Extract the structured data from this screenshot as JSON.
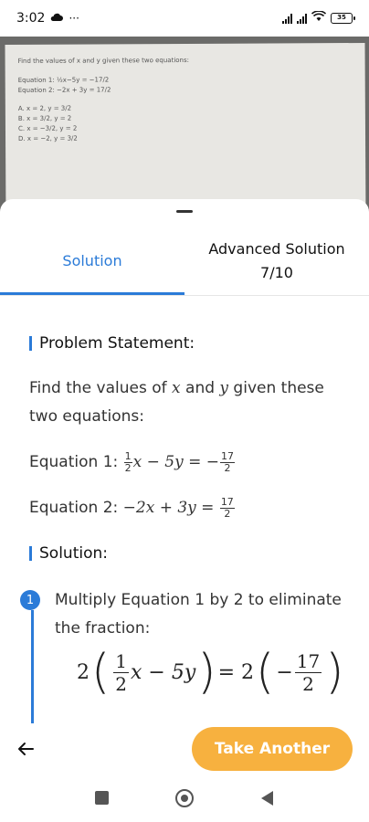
{
  "status_bar": {
    "time": "3:02",
    "battery": "35",
    "icons": [
      "cloud-icon",
      "more-dots-icon",
      "signal-icon",
      "wifi-icon",
      "battery-icon"
    ]
  },
  "photo": {
    "prompt": "Find the values of x and y given these two equations:",
    "eq1": "Equation 1: ½x−5y = −17/2",
    "eq2": "Equation 2: −2x + 3y = 17/2",
    "options": [
      "A. x = 2, y = 3/2",
      "B. x = 3/2, y = 2",
      "C. x = −3/2, y = 2",
      "D. x = −2, y = 3/2"
    ]
  },
  "tabs": [
    {
      "label": "Solution",
      "active": true
    },
    {
      "label": "Advanced Solution",
      "sublabel": "7/10",
      "active": false
    }
  ],
  "problem": {
    "heading": "Problem Statement:",
    "text_a": "Find the values of ",
    "var_x": "x",
    "text_b": " and ",
    "var_y": "y",
    "text_c": " given these two equations:",
    "eq1_label": "Equation 1: ",
    "eq1_frac_num": "1",
    "eq1_frac_den": "2",
    "eq1_mid": "x − 5y = −",
    "eq1_rhs_num": "17",
    "eq1_rhs_den": "2",
    "eq2_label": "Equation 2: ",
    "eq2_mid": "−2x + 3y = ",
    "eq2_rhs_num": "17",
    "eq2_rhs_den": "2"
  },
  "solution": {
    "heading": "Solution:",
    "steps": [
      {
        "number": "1",
        "text": "Multiply Equation 1 by 2 to eliminate the fraction:",
        "math": {
          "lead": "2",
          "frac_num": "1",
          "frac_den": "2",
          "inner": "x − 5y",
          "eq": " = 2",
          "neg": "−",
          "rhs_num": "17",
          "rhs_den": "2"
        }
      }
    ]
  },
  "actions": {
    "take_another": "Take Another"
  },
  "colors": {
    "accent": "#2b7bd8",
    "button": "#f7b13f"
  }
}
